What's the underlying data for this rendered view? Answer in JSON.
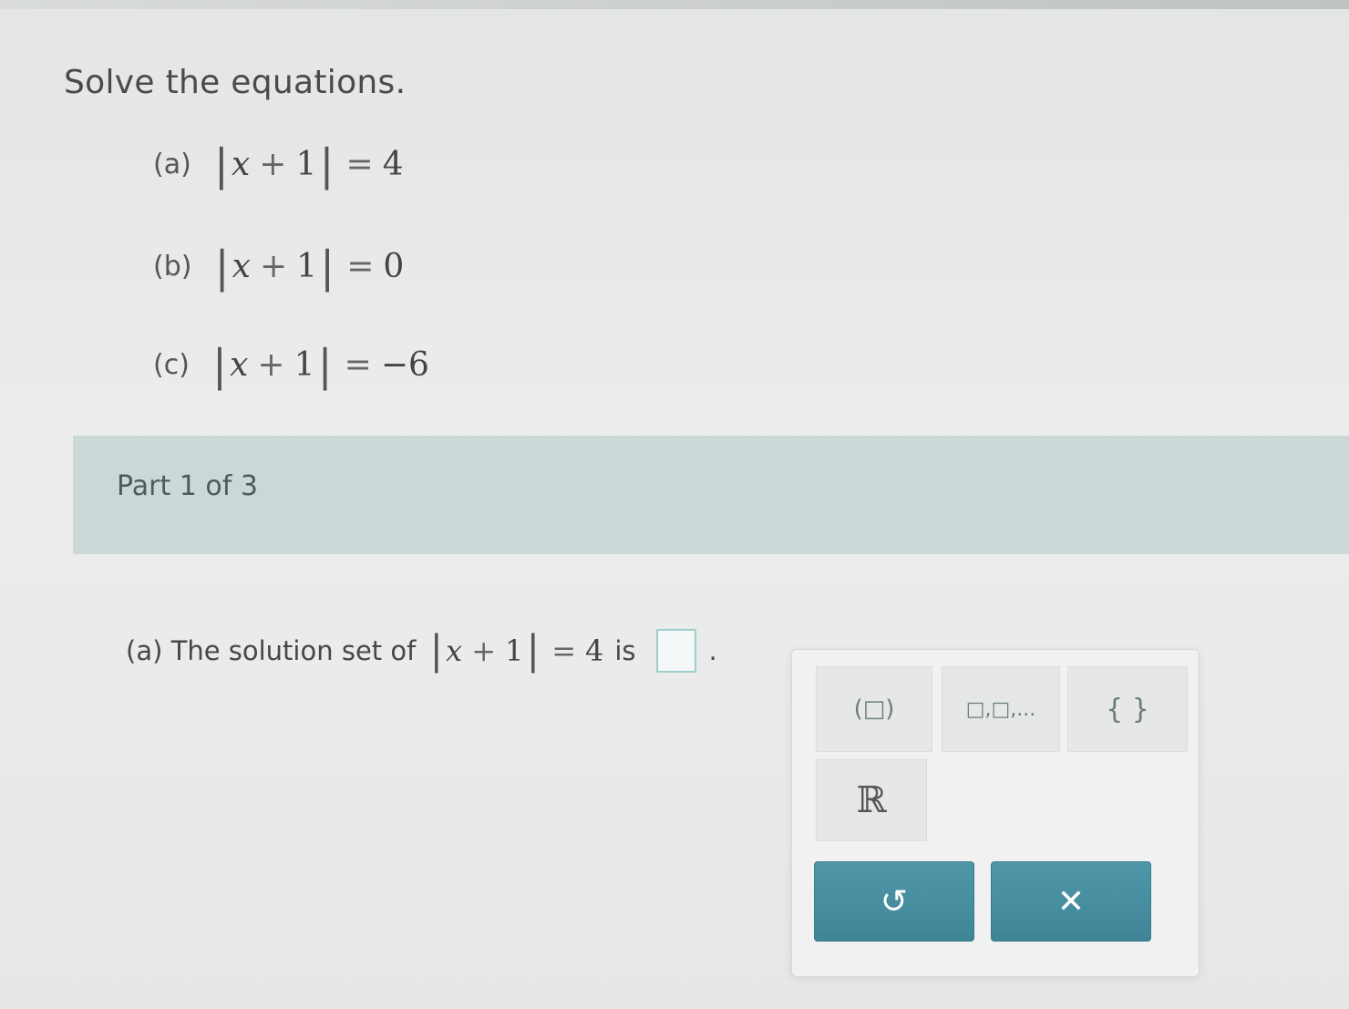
{
  "header": {
    "instruction": "Solve the equations."
  },
  "problems": [
    {
      "label": "(a)",
      "var": "x",
      "op": "+",
      "one": "1",
      "eq": "=",
      "rhs": "4"
    },
    {
      "label": "(b)",
      "var": "x",
      "op": "+",
      "one": "1",
      "eq": "=",
      "rhs": "0"
    },
    {
      "label": "(c)",
      "var": "x",
      "op": "+",
      "one": "1",
      "eq": "=",
      "rhs": "−6"
    }
  ],
  "part": {
    "label": "Part 1 of 3"
  },
  "question": {
    "prefix": "(a) The solution set of",
    "var": "x",
    "op": "+",
    "one": "1",
    "eq": "=",
    "rhs": "4",
    "suffix": "is",
    "period": "."
  },
  "keypad": {
    "interval_key": "(□)",
    "list_key": "□,□,...",
    "set_key": "{ }",
    "reals_key": "ℝ",
    "undo_symbol": "↺",
    "clear_symbol": "✕"
  },
  "colors": {
    "part_bar": "#cad9d8",
    "action_button": "#4a90a2",
    "answer_box_border": "#9ccfcb"
  },
  "icons": {
    "undo": "undo-icon",
    "clear": "close-icon"
  }
}
